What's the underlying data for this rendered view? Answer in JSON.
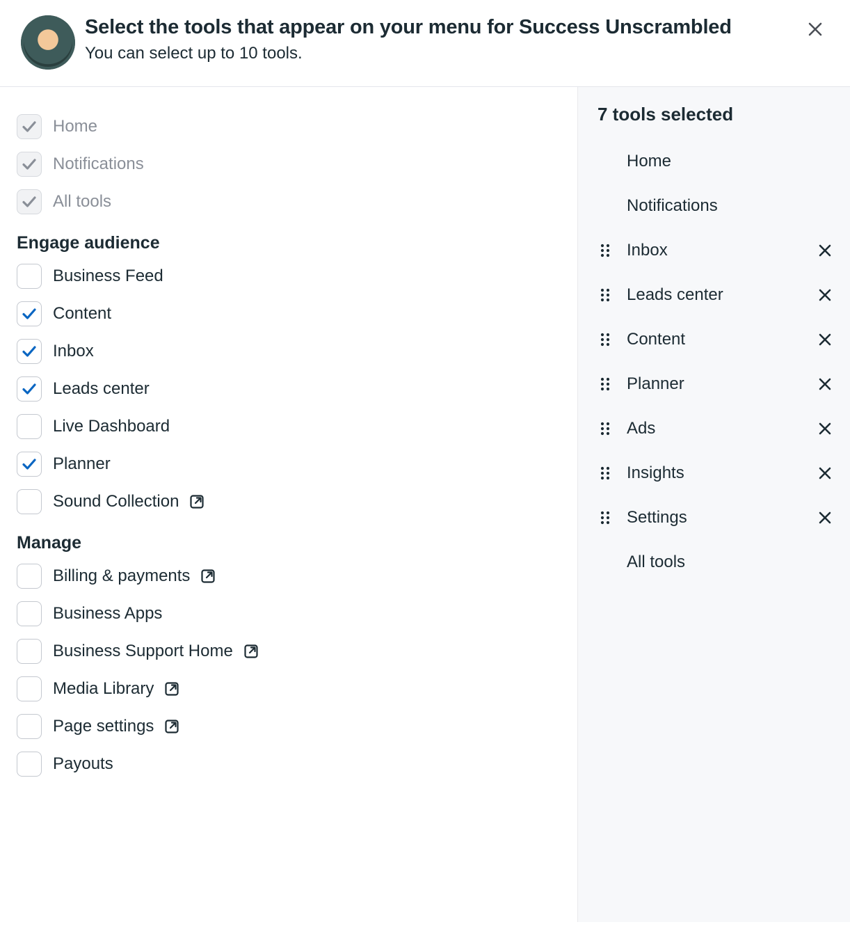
{
  "header": {
    "title": "Select the tools that appear on your menu for Success Unscrambled",
    "subtitle": "You can select up to 10 tools."
  },
  "locked_items": [
    {
      "id": "home",
      "label": "Home"
    },
    {
      "id": "notifications",
      "label": "Notifications"
    },
    {
      "id": "all-tools",
      "label": "All tools"
    }
  ],
  "sections": [
    {
      "title": "Engage audience",
      "items": [
        {
          "id": "business-feed",
          "label": "Business Feed",
          "checked": false,
          "external": false
        },
        {
          "id": "content",
          "label": "Content",
          "checked": true,
          "external": false
        },
        {
          "id": "inbox",
          "label": "Inbox",
          "checked": true,
          "external": false
        },
        {
          "id": "leads-center",
          "label": "Leads center",
          "checked": true,
          "external": false
        },
        {
          "id": "live-dashboard",
          "label": "Live Dashboard",
          "checked": false,
          "external": false
        },
        {
          "id": "planner",
          "label": "Planner",
          "checked": true,
          "external": false
        },
        {
          "id": "sound-collection",
          "label": "Sound Collection",
          "checked": false,
          "external": true
        }
      ]
    },
    {
      "title": "Manage",
      "items": [
        {
          "id": "billing-payments",
          "label": "Billing & payments",
          "checked": false,
          "external": true
        },
        {
          "id": "business-apps",
          "label": "Business Apps",
          "checked": false,
          "external": false
        },
        {
          "id": "business-support-home",
          "label": "Business Support Home",
          "checked": false,
          "external": true
        },
        {
          "id": "media-library",
          "label": "Media Library",
          "checked": false,
          "external": true
        },
        {
          "id": "page-settings",
          "label": "Page settings",
          "checked": false,
          "external": true
        },
        {
          "id": "payouts",
          "label": "Payouts",
          "checked": false,
          "external": false
        }
      ]
    }
  ],
  "selected": {
    "title": "7 tools selected",
    "items": [
      {
        "id": "home",
        "label": "Home",
        "removable": false,
        "draggable": false
      },
      {
        "id": "notifications",
        "label": "Notifications",
        "removable": false,
        "draggable": false
      },
      {
        "id": "inbox",
        "label": "Inbox",
        "removable": true,
        "draggable": true
      },
      {
        "id": "leads-center",
        "label": "Leads center",
        "removable": true,
        "draggable": true
      },
      {
        "id": "content",
        "label": "Content",
        "removable": true,
        "draggable": true
      },
      {
        "id": "planner",
        "label": "Planner",
        "removable": true,
        "draggable": true
      },
      {
        "id": "ads",
        "label": "Ads",
        "removable": true,
        "draggable": true
      },
      {
        "id": "insights",
        "label": "Insights",
        "removable": true,
        "draggable": true
      },
      {
        "id": "settings",
        "label": "Settings",
        "removable": true,
        "draggable": true
      },
      {
        "id": "all-tools",
        "label": "All tools",
        "removable": false,
        "draggable": false
      }
    ]
  }
}
